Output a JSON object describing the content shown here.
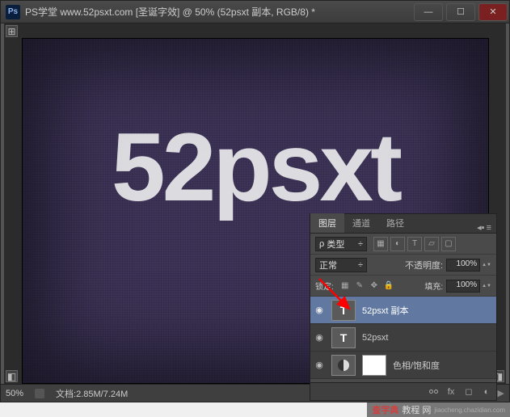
{
  "window": {
    "app_icon_text": "Ps",
    "title": "PS学堂 www.52psxt.com [圣诞字效] @ 50% (52psxt 副本, RGB/8) *"
  },
  "canvas": {
    "text": "52psxt"
  },
  "statusbar": {
    "zoom": "50%",
    "doc_info": "文档:2.85M/7.24M",
    "arrow": "▶"
  },
  "panel": {
    "tabs": {
      "layers": "图层",
      "channels": "通道",
      "paths": "路径"
    },
    "filter": {
      "kind_rho": "ρ",
      "kind_label": "类型",
      "kind_chevron": "÷",
      "icons": {
        "img": "▦",
        "adj": "◐",
        "type": "T",
        "shape": "▱",
        "smart": "▢"
      }
    },
    "blend": {
      "mode": "正常",
      "opacity_label": "不透明度:",
      "opacity_value": "100%"
    },
    "lock": {
      "label": "锁定:",
      "fill_label": "填充:",
      "fill_value": "100%"
    },
    "layers_list": [
      {
        "eye": "◉",
        "thumb_type": "T",
        "name": "52psxt 副本",
        "selected": true
      },
      {
        "eye": "◉",
        "thumb_type": "T",
        "name": "52psxt",
        "selected": false
      },
      {
        "eye": "◉",
        "thumb_type": "adj",
        "name": "色相/饱和度",
        "selected": false
      }
    ],
    "footer_icons": {
      "fx": "fx",
      "mask": "◻",
      "adj": "◐"
    }
  },
  "watermark": {
    "brand_cn": "查字典",
    "brand_suffix": "教程 网",
    "url": "jiaocheng.chazidian.com"
  }
}
